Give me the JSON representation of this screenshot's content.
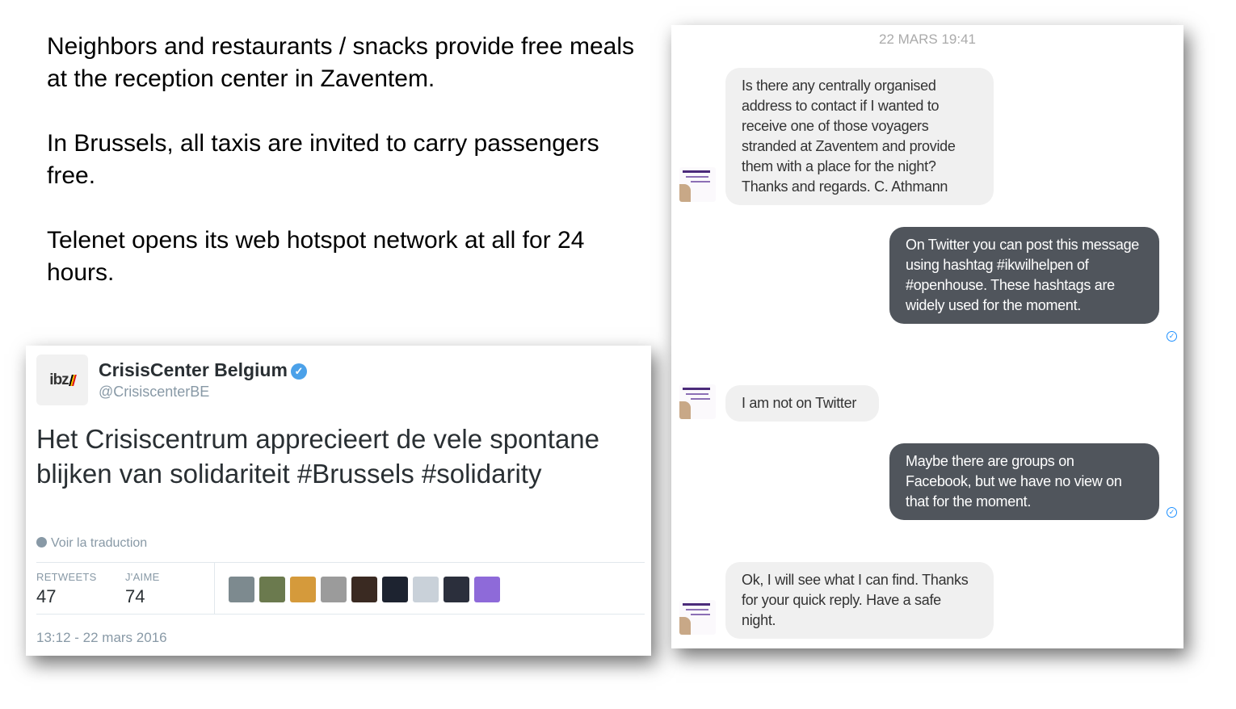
{
  "intro": {
    "p1": "Neighbors and restaurants / snacks provide free meals at the reception center in Zaventem.",
    "p2": "In Brussels, all taxis are invited to carry passengers free.",
    "p3": "Telenet opens its web hotspot network at all for 24 hours."
  },
  "tweet": {
    "avatar_text": "ibz",
    "name": "CrisisCenter Belgium",
    "verified_icon": "verified-badge-icon",
    "handle": "@CrisiscenterBE",
    "text": "Het Crisiscentrum apprecieert de vele spontane blijken van solidariteit #Brussels #solidarity",
    "translate": "Voir la traduction",
    "retweets_label": "RETWEETS",
    "retweets": "47",
    "likes_label": "J'AIME",
    "likes": "74",
    "liker_colors": [
      "#7d8a8f",
      "#6b7a4e",
      "#d59a3b",
      "#9b9b9b",
      "#3a2a22",
      "#1d2330",
      "#c9d1d9",
      "#2b2f3c",
      "#8e6ad9"
    ],
    "date": "13:12 - 22 mars 2016"
  },
  "chat": {
    "timestamp": "22 MARS 19:41",
    "messages": [
      {
        "from": "them",
        "text": "Is there any centrally organised address to contact if I wanted to receive one of those voyagers stranded at Zaventem and provide them with a place for the night? Thanks and regards. C. Athmann"
      },
      {
        "from": "me",
        "text": "On Twitter you can post this message using hashtag #ikwilhelpen of #openhouse. These hashtags are widely used for the moment."
      },
      {
        "from": "them",
        "text": "I am not on Twitter"
      },
      {
        "from": "me",
        "text": "Maybe there are groups on Facebook, but we have no view on that for the moment."
      },
      {
        "from": "them",
        "text": "Ok, I will see what I can find. Thanks for your quick reply. Have a safe night."
      }
    ]
  }
}
